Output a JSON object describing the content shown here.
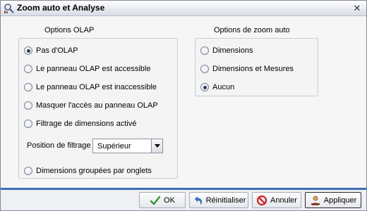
{
  "window": {
    "title": "Zoom auto et Analyse",
    "close_symbol": "✕"
  },
  "olap": {
    "group_title": "Options OLAP",
    "options": [
      {
        "label": "Pas d'OLAP",
        "selected": true
      },
      {
        "label": "Le panneau OLAP est accessible",
        "selected": false
      },
      {
        "label": "Le panneau OLAP est inaccessible",
        "selected": false
      },
      {
        "label": "Masquer l'accès au panneau OLAP",
        "selected": false
      },
      {
        "label": "Filtrage de dimensions activé",
        "selected": false
      }
    ],
    "filter_label": "Position de filtrage",
    "filter_value": "Supérieur",
    "grouped_option": {
      "label": "Dimensions groupées par onglets",
      "selected": false
    }
  },
  "zoom": {
    "group_title": "Options de zoom auto",
    "options": [
      {
        "label": "Dimensions",
        "selected": false
      },
      {
        "label": "Dimensions et Mesures",
        "selected": false
      },
      {
        "label": "Aucun",
        "selected": true
      }
    ]
  },
  "footer": {
    "ok_label": "OK",
    "reset_label": "Réinitialiser",
    "cancel_label": "Annuler",
    "apply_label": "Appliquer"
  },
  "icons": {
    "title": "zoom-analysis-icon",
    "close": "close-icon",
    "ok": "checkmark-icon",
    "reset": "undo-arrow-icon",
    "cancel": "no-entry-icon",
    "apply": "user-apply-icon"
  },
  "colors": {
    "footer_accent": "#3d6fb6",
    "ok_check": "#2e9a2e",
    "cancel_red": "#d42020"
  }
}
